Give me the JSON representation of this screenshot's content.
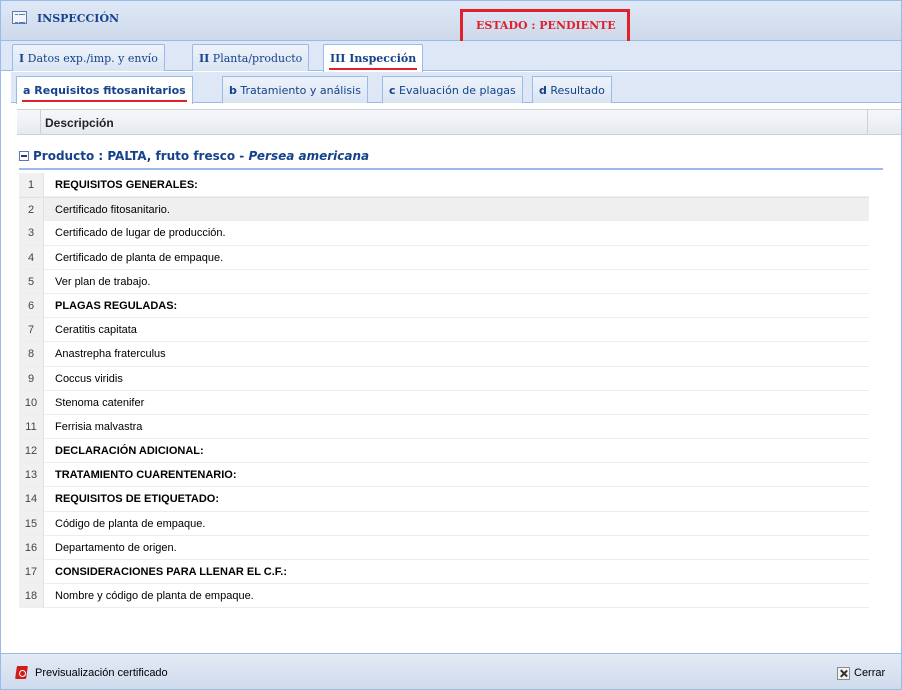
{
  "window": {
    "title": "INSPECCIÓN",
    "status": "ESTADO : PENDIENTE"
  },
  "main_tabs": [
    {
      "prefix": "I",
      "label": "Datos exp./imp. y envío"
    },
    {
      "prefix": "II",
      "label": "Planta/producto"
    },
    {
      "prefix": "III",
      "label": "Inspección"
    }
  ],
  "sub_tabs": [
    {
      "prefix": "a",
      "label": "Requisitos fitosanitarios"
    },
    {
      "prefix": "b",
      "label": "Tratamiento y análisis"
    },
    {
      "prefix": "c",
      "label": "Evaluación de plagas"
    },
    {
      "prefix": "d",
      "label": "Resultado"
    }
  ],
  "grid": {
    "column_header": "Descripción",
    "group": {
      "label": "Producto : PALTA, fruto fresco - ",
      "scientific_name": "Persea americana"
    },
    "rows": [
      {
        "num": "1",
        "text": "REQUISITOS GENERALES:"
      },
      {
        "num": "2",
        "text": "Certificado fitosanitario."
      },
      {
        "num": "3",
        "text": "Certificado de lugar de producción."
      },
      {
        "num": "4",
        "text": "Certificado de planta de empaque."
      },
      {
        "num": "5",
        "text": "Ver plan de trabajo."
      },
      {
        "num": "6",
        "text": "PLAGAS REGULADAS:"
      },
      {
        "num": "7",
        "text": "Ceratitis capitata"
      },
      {
        "num": "8",
        "text": "Anastrepha fraterculus"
      },
      {
        "num": "9",
        "text": "Coccus viridis"
      },
      {
        "num": "10",
        "text": "Stenoma catenifer"
      },
      {
        "num": "11",
        "text": "Ferrisia malvastra"
      },
      {
        "num": "12",
        "text": "DECLARACIÓN ADICIONAL:"
      },
      {
        "num": "13",
        "text": "TRATAMIENTO CUARENTENARIO:"
      },
      {
        "num": "14",
        "text": "REQUISITOS DE ETIQUETADO:"
      },
      {
        "num": "15",
        "text": "Código de planta de empaque."
      },
      {
        "num": "16",
        "text": "Departamento de origen."
      },
      {
        "num": "17",
        "text": "CONSIDERACIONES PARA LLENAR EL C.F.:"
      },
      {
        "num": "18",
        "text": "Nombre y código de planta de empaque."
      }
    ]
  },
  "footer": {
    "preview_label": "Previsualización certificado",
    "close_label": "Cerrar"
  },
  "colors": {
    "accent_red": "#e0202a",
    "header_blue": "#15428b",
    "border_blue": "#99bbe8"
  },
  "icons": {
    "window": "grid-window-icon",
    "group_toggle": "collapse-minus-icon",
    "preview": "pdf-icon",
    "close": "close-icon"
  }
}
